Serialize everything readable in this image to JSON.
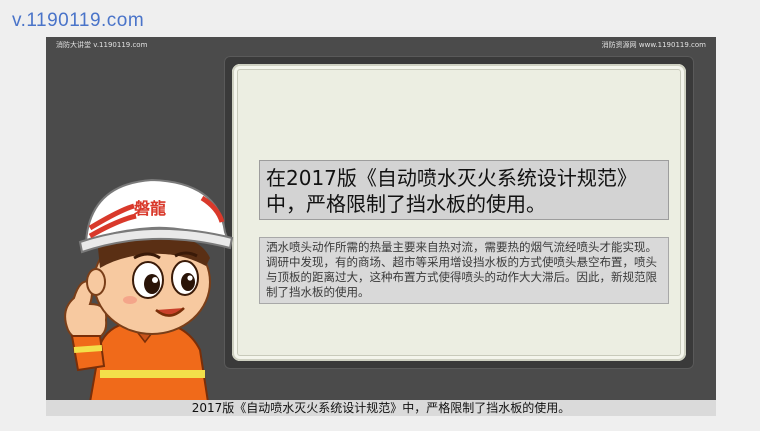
{
  "watermark": "v.1190119.com",
  "header": {
    "left": "消防大讲堂 v.1190119.com",
    "right": "消防资源网 www.1190119.com"
  },
  "board": {
    "title": "在2017版《自动喷水灭火系统设计规范》中，严格限制了挡水板的使用。",
    "body": "洒水喷头动作所需的热量主要来自热对流，需要热的烟气流经喷头才能实现。调研中发现，有的商场、超市等采用增设挡水板的方式使喷头悬空布置，喷头与顶板的距离过大，这种布置方式使得喷头的动作大大滞后。因此，新规范限制了挡水板的使用。"
  },
  "mascot": {
    "helmet_text": "磐龍"
  },
  "caption": "2017版《自动喷水灭火系统设计规范》中，严格限制了挡水板的使用。",
  "colors": {
    "frame": "#4b4b4b",
    "board": "#eceee2",
    "accent_red": "#d9392b",
    "uniform_orange": "#f06a1a"
  }
}
